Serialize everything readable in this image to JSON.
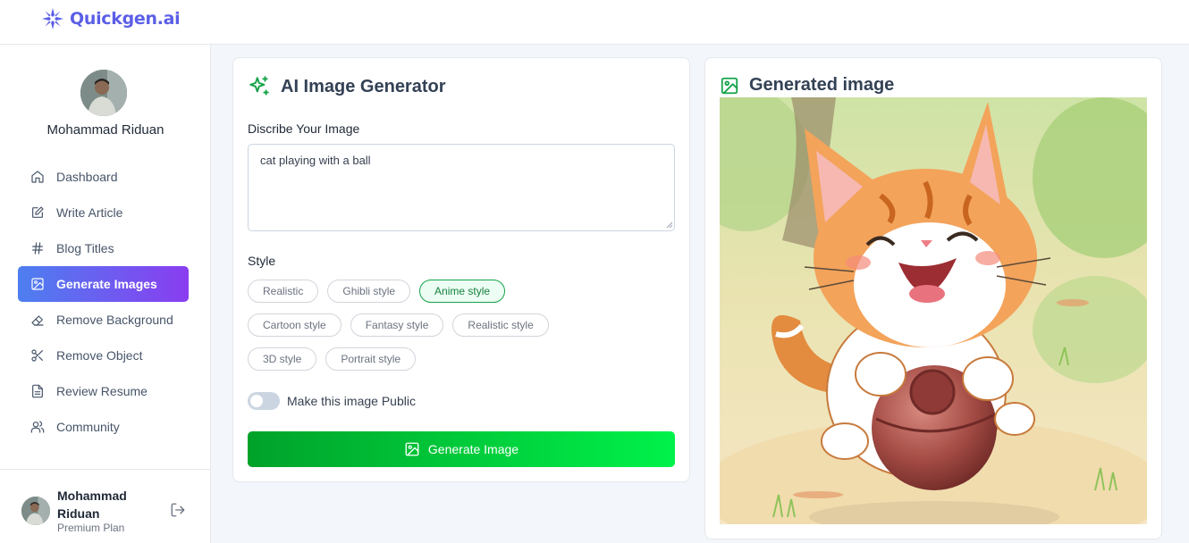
{
  "brand": {
    "name": "Quickgen.ai",
    "color": "#5b5fe6"
  },
  "profile": {
    "name": "Mohammad Riduan"
  },
  "nav": [
    {
      "label": "Dashboard",
      "icon": "home-icon"
    },
    {
      "label": "Write Article",
      "icon": "edit-icon"
    },
    {
      "label": "Blog Titles",
      "icon": "hash-icon"
    },
    {
      "label": "Generate Images",
      "icon": "image-icon",
      "active": true
    },
    {
      "label": "Remove Background",
      "icon": "eraser-icon"
    },
    {
      "label": "Remove Object",
      "icon": "scissors-icon"
    },
    {
      "label": "Review Resume",
      "icon": "file-text-icon"
    },
    {
      "label": "Community",
      "icon": "users-icon"
    }
  ],
  "footer": {
    "name": "Mohammad Riduan",
    "plan": "Premium Plan"
  },
  "generator": {
    "title": "AI Image Generator",
    "prompt_label": "Discribe Your Image",
    "prompt_value": "cat playing with a ball",
    "style_label": "Style",
    "styles": [
      [
        "Realistic",
        "Ghibli style",
        "Anime style"
      ],
      [
        "Cartoon style",
        "Fantasy style",
        "Realistic style"
      ],
      [
        "3D style",
        "Portrait style"
      ]
    ],
    "selected_style": "Anime style",
    "public_toggle_label": "Make this image Public",
    "public_toggle_on": false,
    "generate_button": "Generate Image",
    "accent": "#16a34a"
  },
  "result": {
    "title": "Generated image"
  }
}
